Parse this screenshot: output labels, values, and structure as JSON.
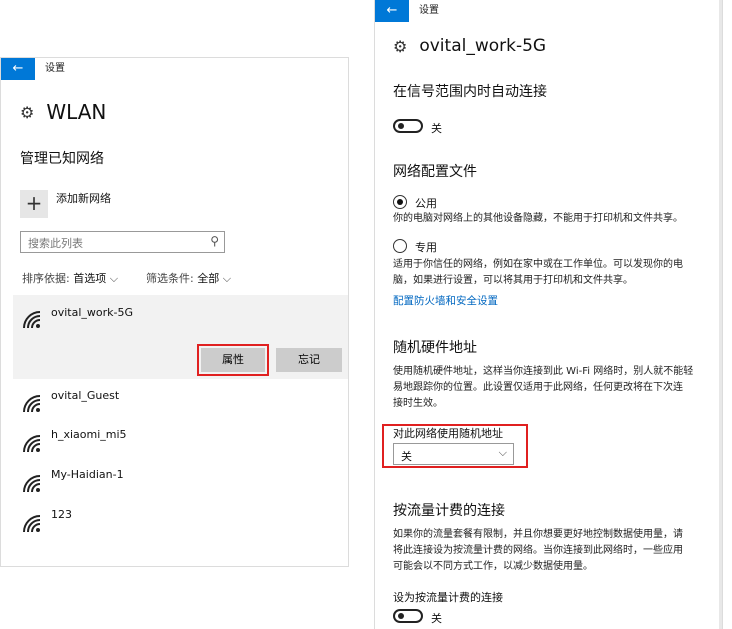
{
  "left": {
    "window_title": "设置",
    "page_title": "WLAN",
    "section_title": "管理已知网络",
    "add_network": "添加新网络",
    "search_placeholder": "搜索此列表",
    "sort_label": "排序依据:",
    "sort_value": "首选项",
    "filter_label": "筛选条件:",
    "filter_value": "全部",
    "networks": [
      "ovital_work-5G",
      "ovital_Guest",
      "h_xiaomi_mi5",
      "My-Haidian-1",
      "123"
    ],
    "properties_button": "属性",
    "forget_button": "忘记"
  },
  "right": {
    "window_title": "设置",
    "page_title": "ovital_work-5G",
    "auto_connect_title": "在信号范围内时自动连接",
    "auto_connect_state": "关",
    "profile_title": "网络配置文件",
    "public_label": "公用",
    "public_desc": "你的电脑对网络上的其他设备隐藏，不能用于打印机和文件共享。",
    "private_label": "专用",
    "private_desc_1": "适用于你信任的网络，例如在家中或在工作单位。可以发现你的电",
    "private_desc_2": "脑，如果进行设置，可以将其用于打印机和文件共享。",
    "firewall_link": "配置防火墙和安全设置",
    "random_title": "随机硬件地址",
    "random_desc_1": "使用随机硬件地址，这样当你连接到此 Wi-Fi 网络时，别人就不能轻",
    "random_desc_2": "易地跟踪你的位置。此设置仅适用于此网络，任何更改将在下次连",
    "random_desc_3": "接时生效。",
    "random_select_label": "对此网络使用随机地址",
    "random_select_value": "关",
    "metered_title": "按流量计费的连接",
    "metered_desc_1": "如果你的流量套餐有限制，并且你想要更好地控制数据使用量，请",
    "metered_desc_2": "将此连接设为按流量计费的网络。当你连接到此网络时，一些应用",
    "metered_desc_3": "可能会以不同方式工作，以减少数据使用量。",
    "metered_toggle_label": "设为按流量计费的连接",
    "metered_state": "关"
  },
  "colors": {
    "accent": "#0078d7",
    "highlight": "#e02020",
    "link": "#0067c0"
  },
  "icons": [
    "back-arrow-icon",
    "gear-icon",
    "plus-icon",
    "search-icon",
    "chevron-down-icon",
    "wifi-icon"
  ]
}
